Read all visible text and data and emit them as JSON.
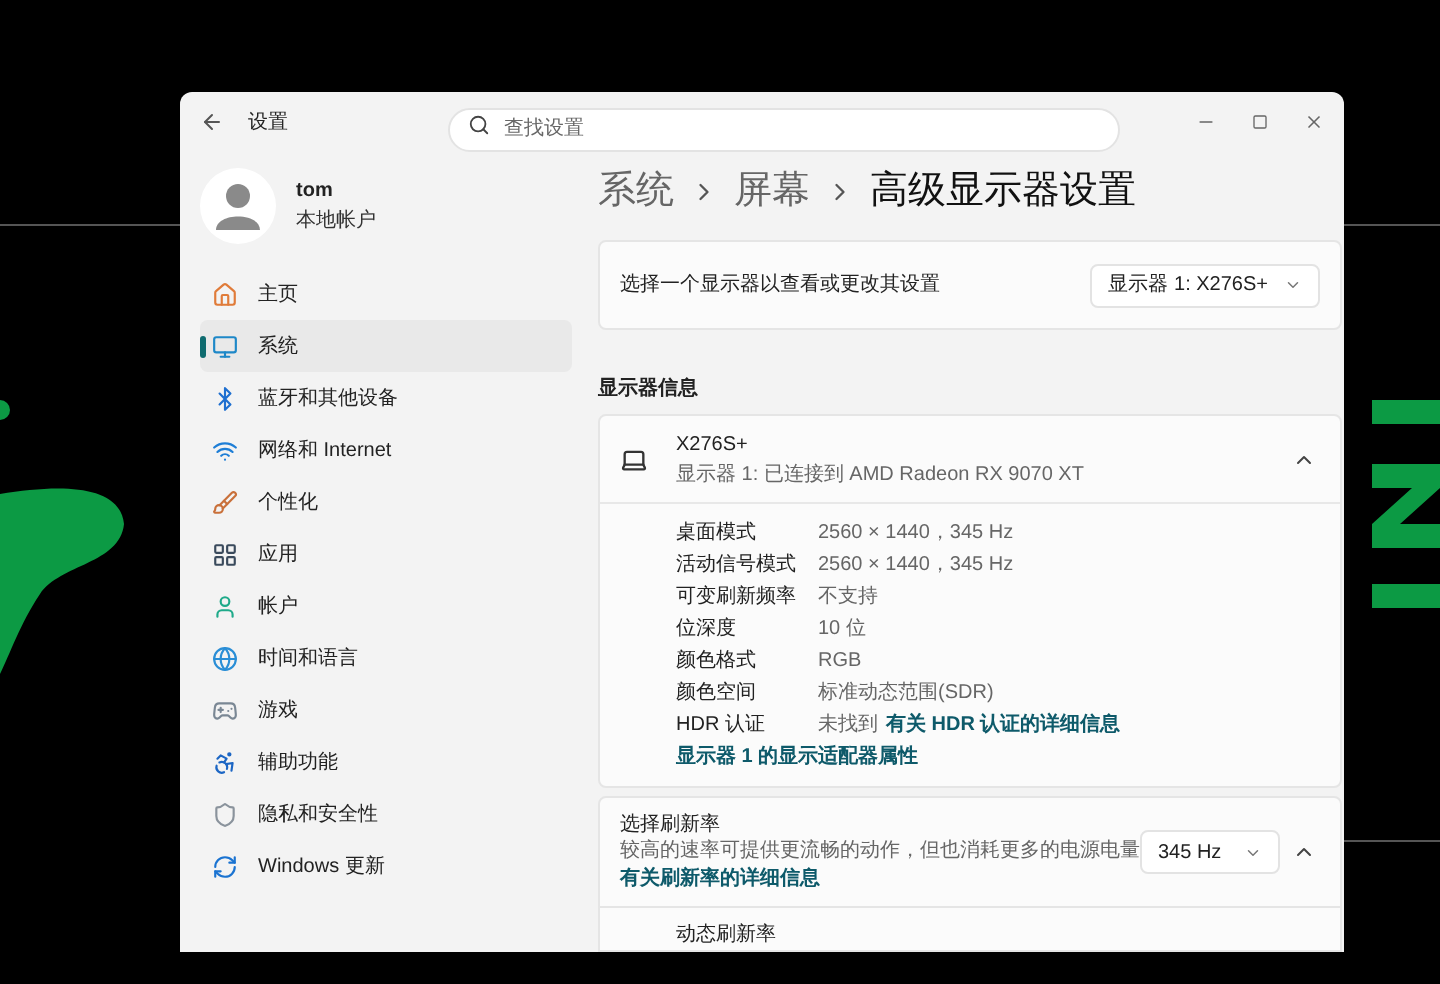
{
  "window": {
    "title": "设置"
  },
  "search": {
    "placeholder": "查找设置"
  },
  "account": {
    "name": "tom",
    "type": "本地帐户"
  },
  "sidebar": {
    "items": [
      {
        "label": "主页",
        "selected": false
      },
      {
        "label": "系统",
        "selected": true
      },
      {
        "label": "蓝牙和其他设备",
        "selected": false
      },
      {
        "label": "网络和 Internet",
        "selected": false
      },
      {
        "label": "个性化",
        "selected": false
      },
      {
        "label": "应用",
        "selected": false
      },
      {
        "label": "帐户",
        "selected": false
      },
      {
        "label": "时间和语言",
        "selected": false
      },
      {
        "label": "游戏",
        "selected": false
      },
      {
        "label": "辅助功能",
        "selected": false
      },
      {
        "label": "隐私和安全性",
        "selected": false
      },
      {
        "label": "Windows 更新",
        "selected": false
      }
    ]
  },
  "breadcrumb": [
    "系统",
    "屏幕",
    "高级显示器设置"
  ],
  "display_select": {
    "label": "选择一个显示器以查看或更改其设置",
    "value": "显示器 1: X276S+"
  },
  "section_heading": "显示器信息",
  "monitor": {
    "name": "X276S+",
    "subtitle": "显示器 1: 已连接到 AMD Radeon RX 9070 XT",
    "expanded": true,
    "details": [
      {
        "label": "桌面模式",
        "value": "2560 × 1440，345 Hz"
      },
      {
        "label": "活动信号模式",
        "value": "2560 × 1440，345 Hz"
      },
      {
        "label": "可变刷新频率",
        "value": "不支持"
      },
      {
        "label": "位深度",
        "value": "10 位"
      },
      {
        "label": "颜色格式",
        "value": "RGB"
      },
      {
        "label": "颜色空间",
        "value": "标准动态范围(SDR)"
      },
      {
        "label": "HDR 认证",
        "value": "未找到",
        "link": "有关 HDR 认证的详细信息"
      }
    ],
    "adapter_link": "显示器 1 的显示适配器属性"
  },
  "refresh": {
    "title": "选择刷新率",
    "description": "较高的速率可提供更流畅的动作，但也消耗更多的电源电量",
    "link": "有关刷新率的详细信息",
    "value": "345 Hz",
    "expanded": true
  },
  "next_row": {
    "label": "动态刷新率"
  }
}
